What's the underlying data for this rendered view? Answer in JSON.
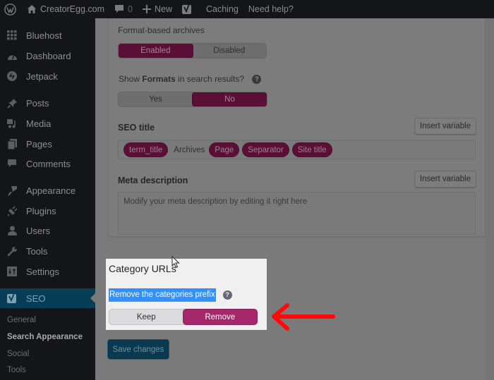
{
  "admin_bar": {
    "site_name": "CreatorEgg.com",
    "comments_count": "0",
    "new_label": "New",
    "caching_label": "Caching",
    "help_label": "Need help?"
  },
  "sidebar": {
    "items": [
      {
        "label": "Bluehost",
        "icon": "grid-icon"
      },
      {
        "label": "Dashboard",
        "icon": "dashboard-gauge-icon"
      },
      {
        "label": "Jetpack",
        "icon": "jetpack-icon"
      },
      {
        "label": "Posts",
        "icon": "pushpin-icon"
      },
      {
        "label": "Media",
        "icon": "media-icon"
      },
      {
        "label": "Pages",
        "icon": "pages-icon"
      },
      {
        "label": "Comments",
        "icon": "comment-bubble-icon"
      },
      {
        "label": "Appearance",
        "icon": "paintbrush-icon"
      },
      {
        "label": "Plugins",
        "icon": "plug-icon"
      },
      {
        "label": "Users",
        "icon": "user-icon"
      },
      {
        "label": "Tools",
        "icon": "wrench-icon"
      },
      {
        "label": "Settings",
        "icon": "settings-sliders-icon"
      },
      {
        "label": "SEO",
        "icon": "yoast-icon",
        "active": true
      }
    ],
    "submenu": [
      {
        "label": "General"
      },
      {
        "label": "Search Appearance",
        "current": true
      },
      {
        "label": "Social"
      },
      {
        "label": "Tools"
      }
    ]
  },
  "format_archives": {
    "label": "Format-based archives",
    "options": [
      "Enabled",
      "Disabled"
    ],
    "selected": "Enabled"
  },
  "show_formats": {
    "label_prefix": "Show ",
    "label_bold": "Formats",
    "label_suffix": " in search results?",
    "help": "?",
    "options": [
      "Yes",
      "No"
    ],
    "selected": "No"
  },
  "seo_title": {
    "label": "SEO title",
    "insert_button": "Insert variable",
    "tokens": [
      {
        "type": "variable",
        "text": "term_title"
      },
      {
        "type": "text",
        "text": "Archives"
      },
      {
        "type": "variable",
        "text": "Page"
      },
      {
        "type": "variable",
        "text": "Separator"
      },
      {
        "type": "variable",
        "text": "Site title"
      }
    ]
  },
  "meta_description": {
    "label": "Meta description",
    "insert_button": "Insert variable",
    "placeholder": "Modify your meta description by editing it right here"
  },
  "category_urls": {
    "heading": "Category URLs",
    "label": "Remove the categories prefix",
    "help": "?",
    "options": [
      "Keep",
      "Remove"
    ],
    "selected": "Remove"
  },
  "save_button": "Save changes",
  "colors": {
    "yoast_purple": "#a4286a",
    "selection_blue": "#3390ff",
    "annotation_red": "#ff0000",
    "wp_active_blue": "#0073aa"
  }
}
